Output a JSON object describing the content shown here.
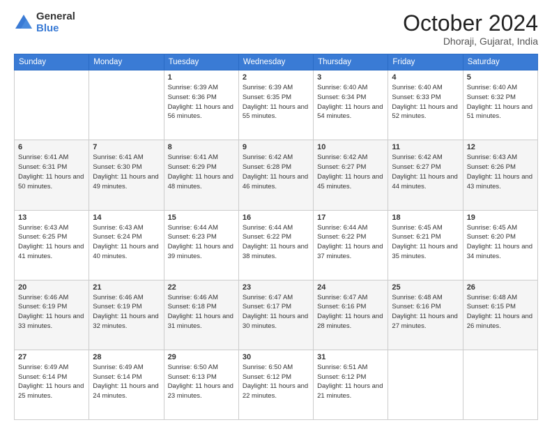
{
  "logo": {
    "general": "General",
    "blue": "Blue"
  },
  "header": {
    "month": "October 2024",
    "location": "Dhoraji, Gujarat, India"
  },
  "weekdays": [
    "Sunday",
    "Monday",
    "Tuesday",
    "Wednesday",
    "Thursday",
    "Friday",
    "Saturday"
  ],
  "weeks": [
    [
      {
        "day": "",
        "info": ""
      },
      {
        "day": "",
        "info": ""
      },
      {
        "day": "1",
        "info": "Sunrise: 6:39 AM\nSunset: 6:36 PM\nDaylight: 11 hours and 56 minutes."
      },
      {
        "day": "2",
        "info": "Sunrise: 6:39 AM\nSunset: 6:35 PM\nDaylight: 11 hours and 55 minutes."
      },
      {
        "day": "3",
        "info": "Sunrise: 6:40 AM\nSunset: 6:34 PM\nDaylight: 11 hours and 54 minutes."
      },
      {
        "day": "4",
        "info": "Sunrise: 6:40 AM\nSunset: 6:33 PM\nDaylight: 11 hours and 52 minutes."
      },
      {
        "day": "5",
        "info": "Sunrise: 6:40 AM\nSunset: 6:32 PM\nDaylight: 11 hours and 51 minutes."
      }
    ],
    [
      {
        "day": "6",
        "info": "Sunrise: 6:41 AM\nSunset: 6:31 PM\nDaylight: 11 hours and 50 minutes."
      },
      {
        "day": "7",
        "info": "Sunrise: 6:41 AM\nSunset: 6:30 PM\nDaylight: 11 hours and 49 minutes."
      },
      {
        "day": "8",
        "info": "Sunrise: 6:41 AM\nSunset: 6:29 PM\nDaylight: 11 hours and 48 minutes."
      },
      {
        "day": "9",
        "info": "Sunrise: 6:42 AM\nSunset: 6:28 PM\nDaylight: 11 hours and 46 minutes."
      },
      {
        "day": "10",
        "info": "Sunrise: 6:42 AM\nSunset: 6:27 PM\nDaylight: 11 hours and 45 minutes."
      },
      {
        "day": "11",
        "info": "Sunrise: 6:42 AM\nSunset: 6:27 PM\nDaylight: 11 hours and 44 minutes."
      },
      {
        "day": "12",
        "info": "Sunrise: 6:43 AM\nSunset: 6:26 PM\nDaylight: 11 hours and 43 minutes."
      }
    ],
    [
      {
        "day": "13",
        "info": "Sunrise: 6:43 AM\nSunset: 6:25 PM\nDaylight: 11 hours and 41 minutes."
      },
      {
        "day": "14",
        "info": "Sunrise: 6:43 AM\nSunset: 6:24 PM\nDaylight: 11 hours and 40 minutes."
      },
      {
        "day": "15",
        "info": "Sunrise: 6:44 AM\nSunset: 6:23 PM\nDaylight: 11 hours and 39 minutes."
      },
      {
        "day": "16",
        "info": "Sunrise: 6:44 AM\nSunset: 6:22 PM\nDaylight: 11 hours and 38 minutes."
      },
      {
        "day": "17",
        "info": "Sunrise: 6:44 AM\nSunset: 6:22 PM\nDaylight: 11 hours and 37 minutes."
      },
      {
        "day": "18",
        "info": "Sunrise: 6:45 AM\nSunset: 6:21 PM\nDaylight: 11 hours and 35 minutes."
      },
      {
        "day": "19",
        "info": "Sunrise: 6:45 AM\nSunset: 6:20 PM\nDaylight: 11 hours and 34 minutes."
      }
    ],
    [
      {
        "day": "20",
        "info": "Sunrise: 6:46 AM\nSunset: 6:19 PM\nDaylight: 11 hours and 33 minutes."
      },
      {
        "day": "21",
        "info": "Sunrise: 6:46 AM\nSunset: 6:19 PM\nDaylight: 11 hours and 32 minutes."
      },
      {
        "day": "22",
        "info": "Sunrise: 6:46 AM\nSunset: 6:18 PM\nDaylight: 11 hours and 31 minutes."
      },
      {
        "day": "23",
        "info": "Sunrise: 6:47 AM\nSunset: 6:17 PM\nDaylight: 11 hours and 30 minutes."
      },
      {
        "day": "24",
        "info": "Sunrise: 6:47 AM\nSunset: 6:16 PM\nDaylight: 11 hours and 28 minutes."
      },
      {
        "day": "25",
        "info": "Sunrise: 6:48 AM\nSunset: 6:16 PM\nDaylight: 11 hours and 27 minutes."
      },
      {
        "day": "26",
        "info": "Sunrise: 6:48 AM\nSunset: 6:15 PM\nDaylight: 11 hours and 26 minutes."
      }
    ],
    [
      {
        "day": "27",
        "info": "Sunrise: 6:49 AM\nSunset: 6:14 PM\nDaylight: 11 hours and 25 minutes."
      },
      {
        "day": "28",
        "info": "Sunrise: 6:49 AM\nSunset: 6:14 PM\nDaylight: 11 hours and 24 minutes."
      },
      {
        "day": "29",
        "info": "Sunrise: 6:50 AM\nSunset: 6:13 PM\nDaylight: 11 hours and 23 minutes."
      },
      {
        "day": "30",
        "info": "Sunrise: 6:50 AM\nSunset: 6:12 PM\nDaylight: 11 hours and 22 minutes."
      },
      {
        "day": "31",
        "info": "Sunrise: 6:51 AM\nSunset: 6:12 PM\nDaylight: 11 hours and 21 minutes."
      },
      {
        "day": "",
        "info": ""
      },
      {
        "day": "",
        "info": ""
      }
    ]
  ]
}
